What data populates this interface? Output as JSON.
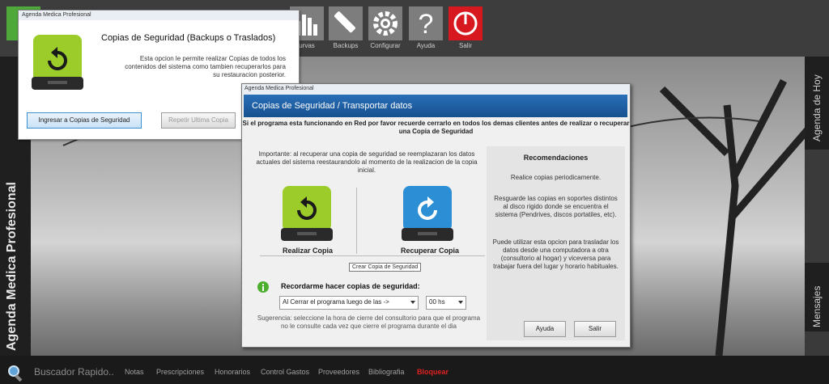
{
  "toolbar": {
    "buttons": [
      {
        "label": "urvas",
        "icon": "chart-icon"
      },
      {
        "label": "Backups",
        "icon": "pencil-icon"
      },
      {
        "label": "Configurar",
        "icon": "gear-icon"
      },
      {
        "label": "Ayuda",
        "icon": "question-icon"
      },
      {
        "label": "Salir",
        "icon": "power-icon"
      }
    ]
  },
  "sidebar": {
    "title": "Agenda Medica Profesional"
  },
  "right_tabs": {
    "agenda": "Agenda de Hoy",
    "mensajes": "Mensajes"
  },
  "bottom_bar": {
    "search_placeholder": "Buscador Rapido..",
    "nav": [
      "Notas",
      "Prescripciones",
      "Honorarios",
      "Control Gastos",
      "Proveedores",
      "Bibliografia",
      "Bloquear"
    ]
  },
  "dialog1": {
    "window_title": "Agenda Medica Profesional",
    "heading": "Copias de Seguridad (Backups o Traslados)",
    "description": "Esta opcion le permite realizar Copias de todos los contenidos del sistema como tambien recuperarlos para su restauracion posterior.",
    "btn_ingresar": "Ingresar a Copias de Seguridad",
    "btn_repetir": "Repetir Ultima Copia"
  },
  "dialog2": {
    "window_title": "Agenda Medica Profesional",
    "header": "Copias de Seguridad / Transportar datos",
    "warning": "Si el programa esta funcionando en Red por favor recuerde cerrarlo en todos los demas clientes antes de realizar o recuperar una Copia de Seguridad",
    "important": "Importante: al recuperar una copia de seguridad se reemplazaran los datos actuales del sistema reestaurandolo al momento de la realizacion de la copia inicial.",
    "realizar_label": "Realizar Copia",
    "recuperar_label": "Recuperar Copia",
    "tooltip": "Crear Copia de Seguridad",
    "remind_label": "Recordarme hacer copias de seguridad:",
    "remind_select": "Al Cerrar el programa luego de las ->",
    "time_select": "00 hs",
    "suggestion": "Sugerencia: seleccione la hora de cierre del consultorio para que el programa no le consulte cada vez que cierre el programa durante el dia",
    "recom_title": "Recomendaciones",
    "recom_1": "Realice copias periodicamente.",
    "recom_2": "Resguarde las copias en soportes distintos al disco rigido donde se encuentra el sistema (Pendrives, discos portatiles, etc).",
    "recom_3": "Puede utilizar esta opcion para trasladar los datos desde una computadora a otra (consultorio al hogar) y viceversa para trabajar fuera del lugar y horario habituales.",
    "btn_ayuda": "Ayuda",
    "btn_salir": "Salir"
  },
  "colors": {
    "accent_blue": "#1b5ea3",
    "salir_red": "#d7191f",
    "bloquear_red": "#e02020",
    "drive_green": "#9ccc2a",
    "drive_blue": "#2c8fd6"
  }
}
